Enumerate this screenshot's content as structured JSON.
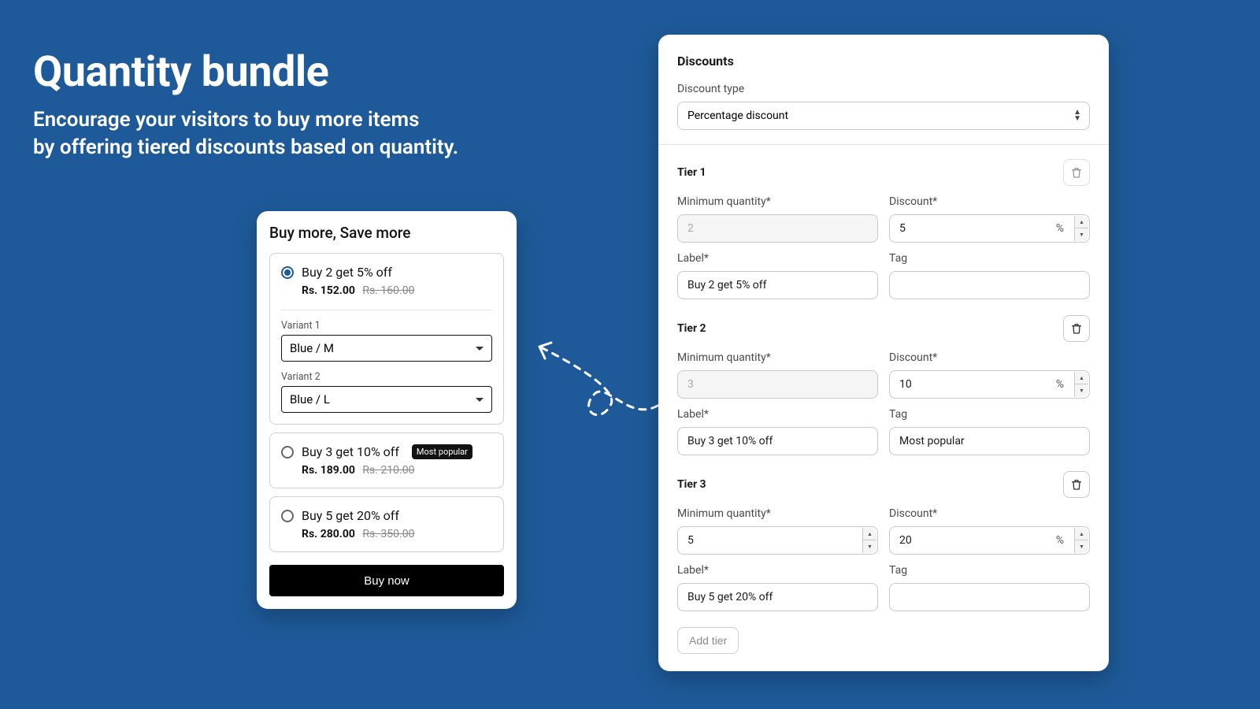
{
  "hero": {
    "title": "Quantity bundle",
    "subtitle_line1": "Encourage your visitors to buy more items",
    "subtitle_line2": "by offering tiered discounts based on quantity."
  },
  "preview": {
    "title": "Buy more, Save more",
    "options": [
      {
        "label": "Buy 2 get 5% off",
        "price": "Rs. 152.00",
        "strike": "Rs. 160.00",
        "selected": true,
        "tag": ""
      },
      {
        "label": "Buy 3 get 10% off",
        "price": "Rs. 189.00",
        "strike": "Rs. 210.00",
        "selected": false,
        "tag": "Most popular"
      },
      {
        "label": "Buy 5 get 20% off",
        "price": "Rs. 280.00",
        "strike": "Rs. 350.00",
        "selected": false,
        "tag": ""
      }
    ],
    "variant1_label": "Variant 1",
    "variant1_value": "Blue / M",
    "variant2_label": "Variant 2",
    "variant2_value": "Blue / L",
    "buy_label": "Buy now"
  },
  "settings": {
    "heading": "Discounts",
    "discount_type_label": "Discount type",
    "discount_type_value": "Percentage discount",
    "min_qty_label": "Minimum quantity*",
    "discount_label_col": "Discount*",
    "label_col": "Label*",
    "tag_col": "Tag",
    "tiers": [
      {
        "name": "Tier 1",
        "qty": "2",
        "qty_disabled": true,
        "discount": "5",
        "label": "Buy 2 get 5% off",
        "tag": "",
        "trash_disabled": true
      },
      {
        "name": "Tier 2",
        "qty": "3",
        "qty_disabled": true,
        "discount": "10",
        "label": "Buy 3 get 10% off",
        "tag": "Most popular",
        "trash_disabled": false
      },
      {
        "name": "Tier 3",
        "qty": "5",
        "qty_disabled": false,
        "discount": "20",
        "label": "Buy 5 get 20% off",
        "tag": "",
        "trash_disabled": false
      }
    ],
    "add_tier_label": "Add tier"
  }
}
